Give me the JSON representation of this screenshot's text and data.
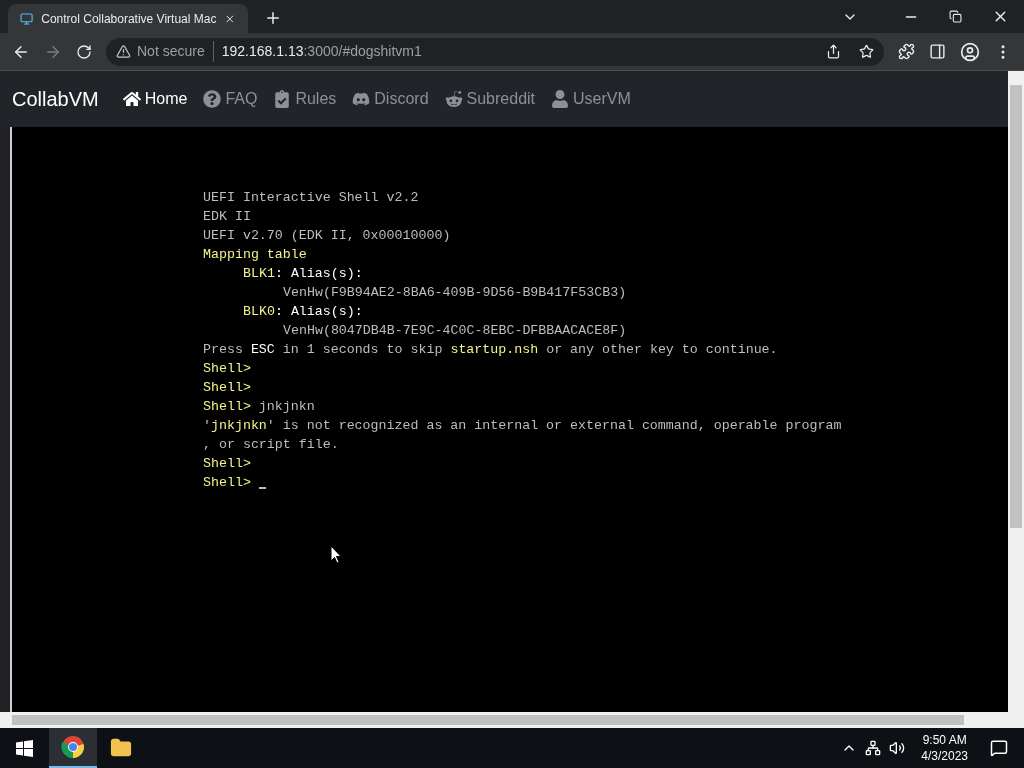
{
  "tab": {
    "title": "Control Collaborative Virtual Mac",
    "selected": true
  },
  "address": {
    "security": "Not secure",
    "host": "192.168.1.13",
    "path": ":3000/#dogshitvm1"
  },
  "navbar": {
    "brand": "CollabVM",
    "items": [
      {
        "label": "Home",
        "kind": "home",
        "selected": true
      },
      {
        "label": "FAQ",
        "kind": "faq",
        "selected": false
      },
      {
        "label": "Rules",
        "kind": "rules",
        "selected": false
      },
      {
        "label": "Discord",
        "kind": "discord",
        "selected": false
      },
      {
        "label": "Subreddit",
        "kind": "reddit",
        "selected": false
      },
      {
        "label": "UserVM",
        "kind": "user",
        "selected": false
      }
    ]
  },
  "terminal": {
    "lines": [
      {
        "segments": [
          {
            "text": "UEFI Interactive Shell v2.2",
            "kind": "plain"
          }
        ]
      },
      {
        "segments": [
          {
            "text": "EDK II",
            "kind": "plain"
          }
        ]
      },
      {
        "segments": [
          {
            "text": "UEFI v2.70 (EDK II, 0x00010000)",
            "kind": "plain"
          }
        ]
      },
      {
        "segments": [
          {
            "text": "Mapping table",
            "kind": "yellow"
          }
        ],
        "children": [
          {
            "segments": [
              {
                "text": "BLK1",
                "kind": "yellow"
              },
              {
                "text": ": Alias(s):",
                "kind": "bright"
              }
            ],
            "children": [
              {
                "segments": [
                  {
                    "text": "VenHw(F9B94AE2-8BA6-409B-9D56-B9B417F53CB3)",
                    "kind": "plain"
                  }
                ]
              }
            ]
          },
          {
            "segments": [
              {
                "text": "BLK0",
                "kind": "yellow"
              },
              {
                "text": ": Alias(s):",
                "kind": "bright"
              }
            ],
            "children": [
              {
                "segments": [
                  {
                    "text": "VenHw(8047DB4B-7E9C-4C0C-8EBC-DFBBAACACE8F)",
                    "kind": "plain"
                  }
                ]
              }
            ]
          }
        ]
      },
      {
        "segments": [
          {
            "text": "Press ",
            "kind": "plain"
          },
          {
            "text": "ESC",
            "kind": "bright"
          },
          {
            "text": " in 1 seconds to skip ",
            "kind": "plain"
          },
          {
            "text": "startup.nsh",
            "kind": "yellow"
          },
          {
            "text": " or any other key to continue.",
            "kind": "plain"
          }
        ]
      },
      {
        "segments": [
          {
            "text": "Shell>",
            "kind": "yellow"
          }
        ]
      },
      {
        "segments": [
          {
            "text": "Shell>",
            "kind": "yellow"
          }
        ]
      },
      {
        "segments": [
          {
            "text": "Shell>",
            "kind": "yellow"
          },
          {
            "text": " jnkjnkn",
            "kind": "plain"
          }
        ]
      },
      {
        "segments": [
          {
            "text": "'",
            "kind": "plain"
          },
          {
            "text": "jnkjnkn",
            "kind": "yellow"
          },
          {
            "text": "' is not recognized as an internal or external command, operable program",
            "kind": "plain"
          }
        ]
      },
      {
        "segments": [
          {
            "text": ", or script file.",
            "kind": "plain"
          }
        ]
      },
      {
        "segments": [
          {
            "text": "Shell>",
            "kind": "yellow"
          }
        ]
      },
      {
        "segments": [
          {
            "text": "Shell>",
            "kind": "yellow"
          }
        ],
        "cursor": true
      }
    ]
  },
  "taskbar": {
    "time": "9:50 AM",
    "date": "4/3/2023"
  }
}
